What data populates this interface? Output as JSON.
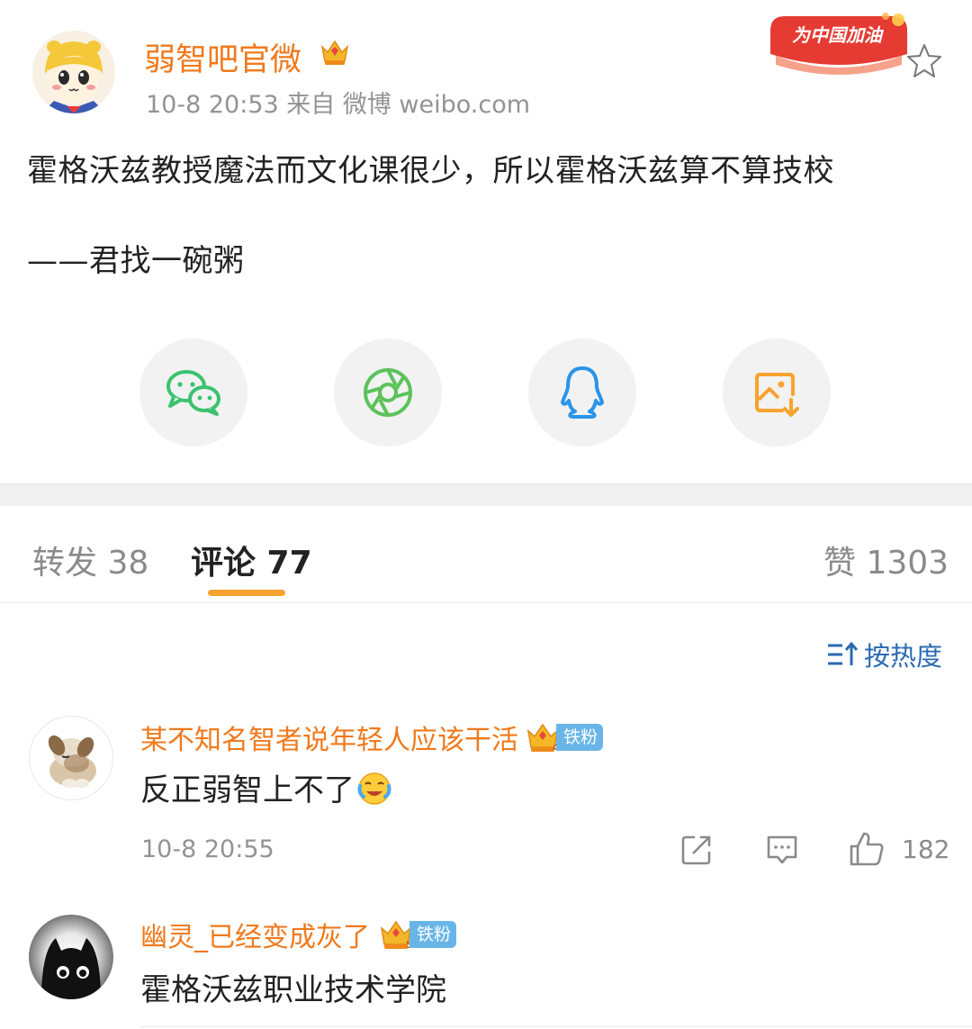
{
  "post": {
    "author": "弱智吧官微",
    "meta": "10-8 20:53  来自 微博 weibo.com",
    "badge_text": "为中国加油",
    "line1": "霍格沃兹教授魔法而文化课很少，所以霍格沃兹算不算技校",
    "line2": "——君找一碗粥"
  },
  "share": [
    {
      "icon": "wechat-icon",
      "color": "#3cc26f"
    },
    {
      "icon": "moments-icon",
      "color": "#5cc25a"
    },
    {
      "icon": "qq-icon",
      "color": "#2a94e8"
    },
    {
      "icon": "save-image-icon",
      "color": "#f7a32f"
    }
  ],
  "tabs": {
    "repost": "转发 38",
    "comments": "评论 77",
    "likes": "赞 1303"
  },
  "sort": {
    "label": "按热度"
  },
  "comments": [
    {
      "name": "某不知名智者说年轻人应该干活",
      "fan_label": "铁粉",
      "fan_level": "4",
      "text": "反正弱智上不了",
      "time": "10-8 20:55",
      "likes": "182"
    },
    {
      "name": "幽灵_已经变成灰了",
      "fan_label": "铁粉",
      "fan_level": "5",
      "text": "霍格沃兹职业技术学院"
    }
  ],
  "colors": {
    "accent": "#f0791c",
    "tab_indicator": "#f7a32f",
    "link": "#2a6ab2",
    "fan_badge": "#69b5e8"
  }
}
